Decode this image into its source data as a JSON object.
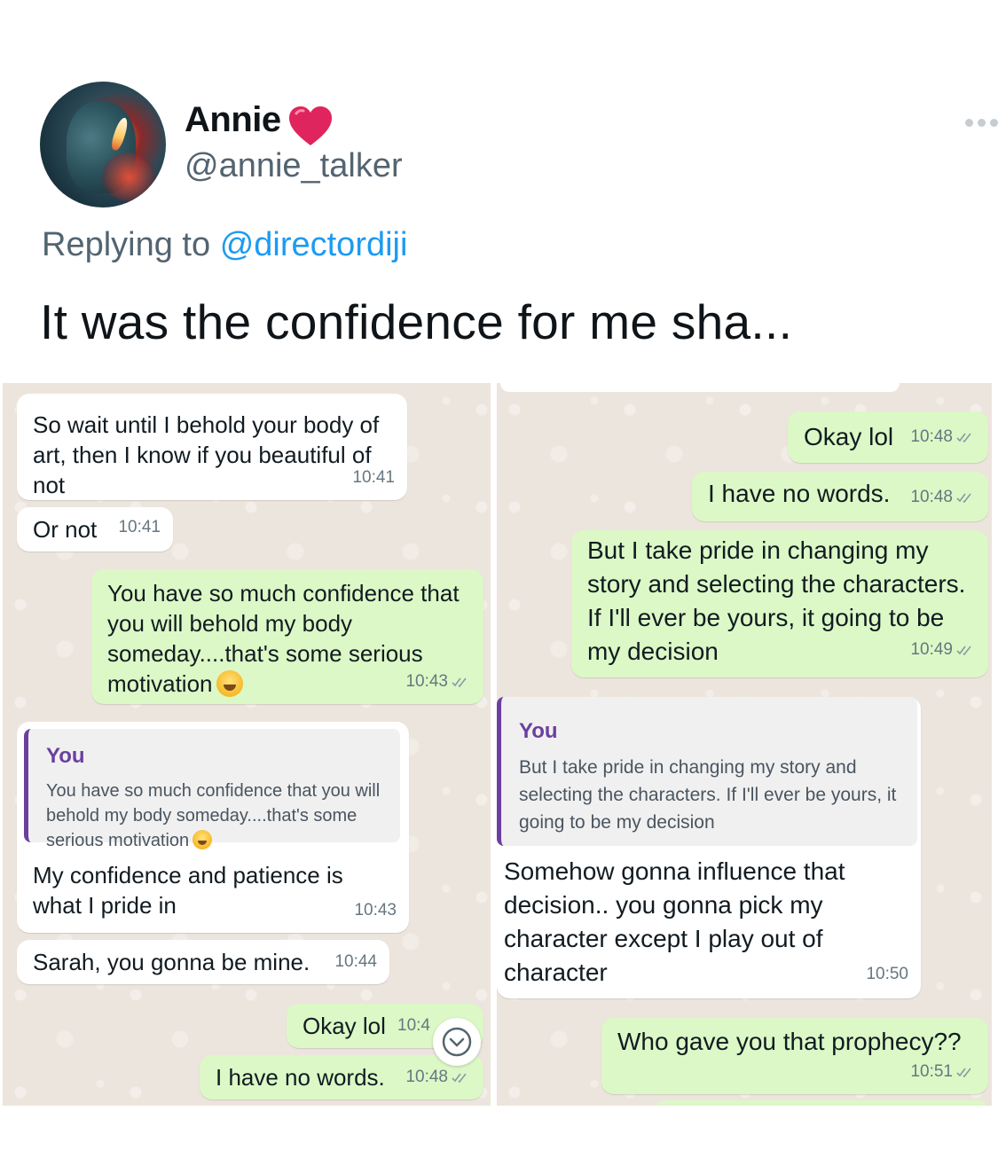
{
  "tweet": {
    "display_name": "Annie",
    "handle": "@annie_talker",
    "reply_prefix": "Replying to",
    "reply_to": "@directordiji",
    "text": "It was the confidence for me sha...",
    "icons": {
      "avatar": "profile-photo",
      "badge": "red-heart-icon",
      "menu": "more-options-icon"
    }
  },
  "chat_left": {
    "messages": [
      {
        "text": "So wait until I behold your body of art, then I know if you beautiful of not",
        "time": "10:41"
      },
      {
        "text": "Or not",
        "time": "10:41"
      },
      {
        "text": "You have so much confidence that you will behold my body someday....that's some serious motivation",
        "time": "10:43"
      },
      {
        "quote_author": "You",
        "quote_text": "You have so much confidence that you will behold my body someday....that's some serious motivation",
        "text": "My confidence and patience is what I pride in",
        "time": "10:43"
      },
      {
        "text": "Sarah, you gonna be mine.",
        "time": "10:44"
      },
      {
        "text": "Okay lol",
        "time": "10:4"
      },
      {
        "text": "I have no words.",
        "time": "10:48"
      }
    ]
  },
  "chat_right": {
    "messages": [
      {
        "text": "Okay lol",
        "time": "10:48"
      },
      {
        "text": "I have no words.",
        "time": "10:48"
      },
      {
        "text": "But I take pride in changing my story and selecting the characters. If I'll ever be yours, it going to be my decision",
        "time": "10:49"
      },
      {
        "quote_author": "You",
        "quote_text": "But I take pride in changing my story and selecting the characters. If I'll ever be yours, it going to be my decision",
        "text": "Somehow gonna influence that decision.. you gonna pick my character except I play out of character",
        "time": "10:50"
      },
      {
        "text": "Who gave you that prophecy??",
        "time": "10:51"
      }
    ]
  },
  "colors": {
    "incoming_bubble": "#ffffff",
    "outgoing_bubble": "#dcf8c6",
    "chat_background": "#ece5dd",
    "quote_accent": "#6b3fa0",
    "mention_link": "#1d9bf0",
    "heart": "#e0245e"
  }
}
